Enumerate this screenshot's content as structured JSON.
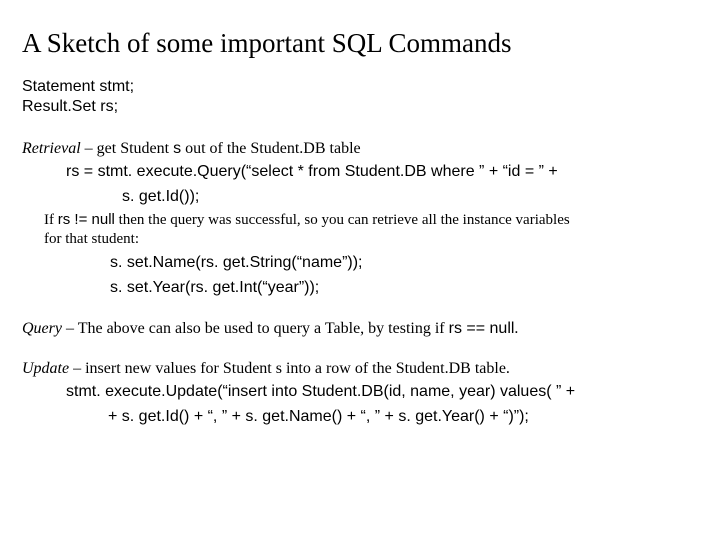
{
  "title": "A Sketch of some important SQL Commands",
  "decl": {
    "line1": "Statement stmt;",
    "line2": "Result.Set rs;"
  },
  "retrieval": {
    "label": "Retrieval",
    "desc_pre": " – get Student ",
    "desc_s": "s",
    "desc_post": " out of the Student.DB table",
    "code1": "rs = stmt. execute.Query(“select * from Student.DB where ” + “id = ” +",
    "code2": "s. get.Id());",
    "note_pre": "If ",
    "note_cond": "rs != null",
    "note_mid": " then the query was successful, so you can retrieve all the instance variables",
    "note_line2": "for that student:",
    "set1": "s. set.Name(rs. get.String(“name”));",
    "set2": "s. set.Year(rs. get.Int(“year”));"
  },
  "query": {
    "label": "Query",
    "desc_pre": " – The above can also be used to query a Table, by testing if ",
    "cond": "rs == null",
    "desc_post": "."
  },
  "update": {
    "label": "Update",
    "desc": " – insert new values for Student s into a row of the Student.DB table.",
    "code1": "stmt. execute.Update(“insert into Student.DB(id, name, year) values( ” +",
    "code2": "+ s. get.Id() + “, ” + s. get.Name() + “, ” + s. get.Year() + “)”);"
  }
}
